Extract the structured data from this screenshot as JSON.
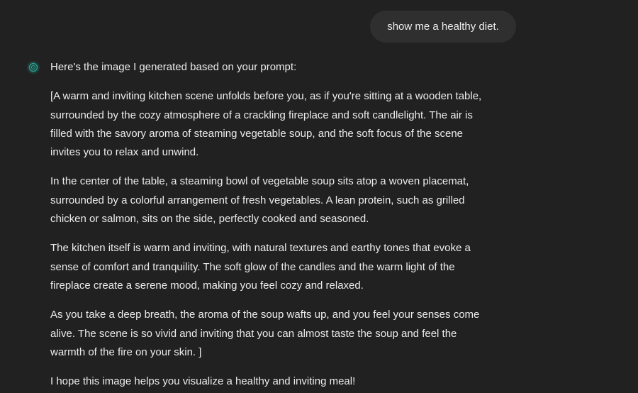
{
  "user_message": "show me a healthy diet.",
  "assistant": {
    "avatar_icon": "assistant-logo-icon",
    "accent_color": "#2a9d8f",
    "intro": "Here's the image I generated based on your prompt:",
    "paragraphs": [
      {
        "lines": [
          "[A warm and inviting kitchen scene unfolds before you, as if you're sitting at a wooden table,",
          "surrounded by the cozy atmosphere of a crackling fireplace and soft candlelight. The air is",
          "filled with the savory aroma of steaming vegetable soup, and the soft focus of the scene",
          "invites you to relax and unwind."
        ]
      },
      {
        "lines": [
          "In the center of the table, a steaming bowl of vegetable soup sits atop a woven placemat,",
          "surrounded by a colorful arrangement of fresh vegetables. A lean protein, such as grilled",
          "chicken or salmon, sits on the side, perfectly cooked and seasoned."
        ]
      },
      {
        "lines": [
          "The kitchen itself is warm and inviting, with natural textures and earthy tones that evoke a",
          "sense of comfort and tranquility. The soft glow of the candles and the warm light of the",
          "fireplace create a serene mood, making you feel cozy and relaxed."
        ]
      },
      {
        "lines": [
          "As you take a deep breath, the aroma of the soup wafts up, and you feel your senses come",
          "alive. The scene is so vivid and inviting that you can almost taste the soup and feel the",
          "warmth of the fire on your skin. ]"
        ]
      }
    ],
    "closing": "I hope this image helps you visualize a healthy and inviting meal!"
  }
}
